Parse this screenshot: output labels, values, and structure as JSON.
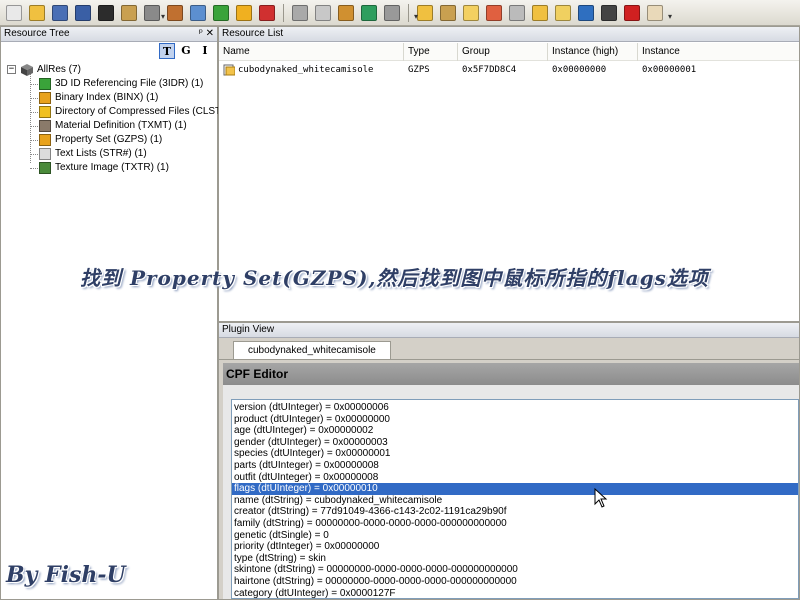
{
  "toolbar": {
    "icons": [
      "new-icon",
      "open-icon",
      "save-icon",
      "save-as-icon",
      "close-icon",
      "tools-icon",
      "settings-icon",
      "package-icon",
      "document-icon",
      "link-icon",
      "refresh-icon",
      "mail-icon",
      "delete-icon",
      "cut-icon",
      "image-icon",
      "plugin-icon",
      "tools2-icon",
      "folder-open-icon",
      "save-icon",
      "note-icon",
      "delete-note-icon",
      "comment-icon",
      "note2-icon",
      "note3-icon",
      "sync-icon",
      "hat-icon",
      "close-red-icon",
      "eraser-icon"
    ]
  },
  "tree_panel": {
    "title": "Resource Tree",
    "view_buttons": [
      "T",
      "G",
      "I"
    ],
    "root": {
      "label": "AllRes (7)",
      "expander": "−"
    },
    "items": [
      {
        "label": "3D ID Referencing File (3IDR) (1)",
        "icon_color": "#3aa33a"
      },
      {
        "label": "Binary Index (BINX) (1)",
        "icon_color": "#e8a21c"
      },
      {
        "label": "Directory of Compressed Files (CLST) (1)",
        "icon_color": "#f0c020"
      },
      {
        "label": "Material Definition (TXMT) (1)",
        "icon_color": "#8a7a6a"
      },
      {
        "label": "Property Set (GZPS) (1)",
        "icon_color": "#e8a21c"
      },
      {
        "label": "Text Lists (STR#) (1)",
        "icon_color": "#dcdcdc"
      },
      {
        "label": "Texture Image (TXTR) (1)",
        "icon_color": "#4a8a3a"
      }
    ]
  },
  "list_panel": {
    "title": "Resource List",
    "columns": [
      "Name",
      "Type",
      "Group",
      "Instance (high)",
      "Instance"
    ],
    "rows": [
      {
        "name": "cubodynaked_whitecamisole",
        "type": "GZPS",
        "group": "0x5F7DD8C4",
        "instance_high": "0x00000000",
        "instance": "0x00000001"
      }
    ]
  },
  "plugin_panel": {
    "title": "Plugin View",
    "tab": "cubodynaked_whitecamisole",
    "editor_title": "CPF Editor",
    "selected_index": 7,
    "properties": [
      "version (dtUInteger) = 0x00000006",
      "product (dtUInteger) = 0x00000000",
      "age (dtUInteger) = 0x00000002",
      "gender (dtUInteger) = 0x00000003",
      "species (dtUInteger) = 0x00000001",
      "parts (dtUInteger) = 0x00000008",
      "outfit (dtUInteger) = 0x00000008",
      "flags (dtUInteger) = 0x00000010",
      "name (dtString) = cubodynaked_whitecamisole",
      "creator (dtString) = 77d91049-4366-c143-2c02-1191ca29b90f",
      "family (dtString) = 00000000-0000-0000-0000-000000000000",
      "genetic (dtSingle) = 0",
      "priority (dtInteger) = 0x00000000",
      "type (dtString) = skin",
      "skintone (dtString) = 00000000-0000-0000-0000-000000000000",
      "hairtone (dtString) = 00000000-0000-0000-0000-000000000000",
      "category (dtUInteger) = 0x0000127F"
    ]
  },
  "overlay": {
    "instruction": "找到 Property Set(GZPS),然后找到图中鼠标所指的flags选项",
    "signature": "By Fish-U"
  }
}
